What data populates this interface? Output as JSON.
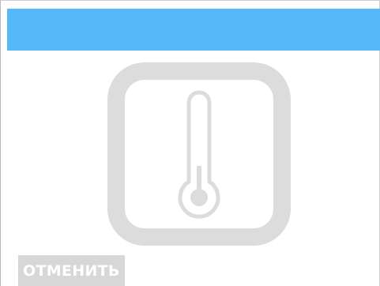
{
  "header": {
    "bar_color": "#55b8f9"
  },
  "illustration": {
    "icon": "thermometer-icon",
    "color": "#dcdcdc"
  },
  "actions": {
    "cancel_label": "ОТМЕНИТЬ"
  }
}
